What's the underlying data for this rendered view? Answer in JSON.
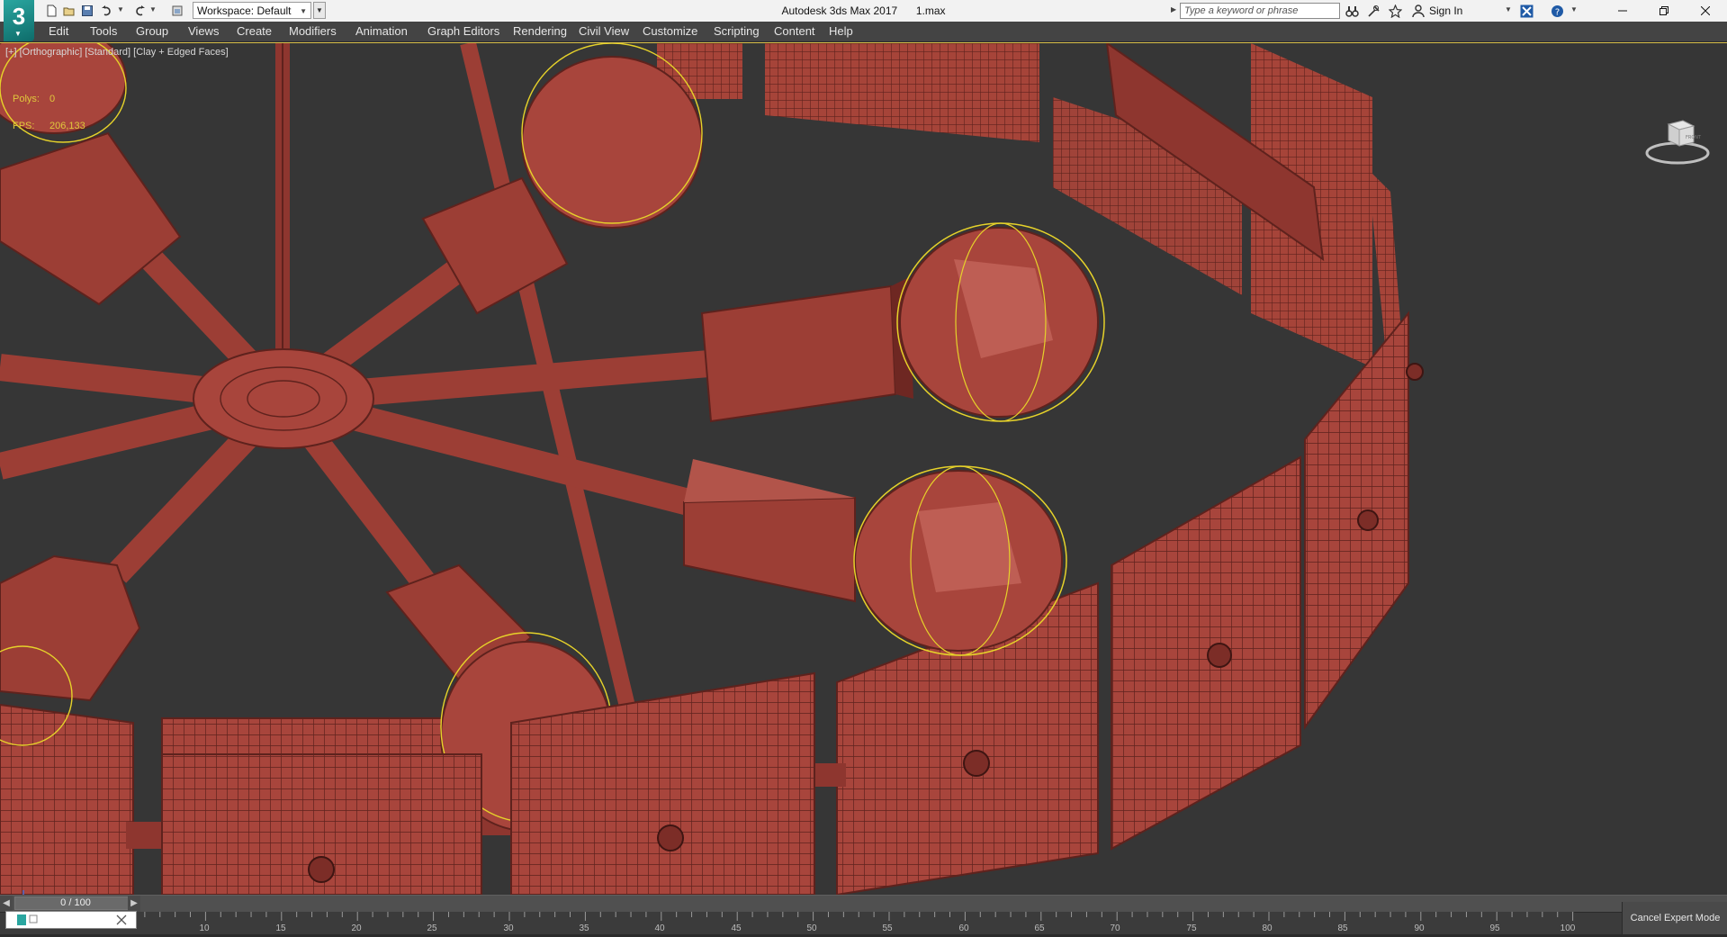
{
  "titlebar": {
    "workspace_label": "Workspace: Default",
    "app_name": "Autodesk 3ds Max 2017",
    "file_name": "1.max",
    "search_placeholder": "Type a keyword or phrase",
    "sign_in": "Sign In",
    "logo_glyph": "3"
  },
  "menu": {
    "items": [
      "Edit",
      "Tools",
      "Group",
      "Views",
      "Create",
      "Modifiers",
      "Animation",
      "Graph Editors",
      "Rendering",
      "Civil View",
      "Customize",
      "Scripting",
      "Content",
      "Help"
    ]
  },
  "viewport": {
    "label": "[+] [Orthographic] [Standard] [Clay + Edged Faces]",
    "stats": {
      "polys_label": "Polys:",
      "polys_value": "0",
      "fps_label": "FPS:",
      "fps_value": "206,133"
    },
    "viewcube_text": "FRONT",
    "colors": {
      "background": "#363636",
      "clay": "#a8453c",
      "clay_dark": "#6e2722",
      "clay_light": "#c86a5e",
      "selection": "#e6d22a",
      "active_border": "#d9c14a"
    }
  },
  "timeline": {
    "frame_counter": "0 / 100",
    "ticks": [
      "10",
      "15",
      "20",
      "25",
      "30",
      "35",
      "40",
      "45",
      "50",
      "55",
      "60",
      "65",
      "70",
      "75",
      "80",
      "85",
      "90",
      "95",
      "100"
    ],
    "cancel_expert": "Cancel Expert Mode"
  },
  "icons": [
    "app-logo",
    "new-file-icon",
    "open-file-icon",
    "save-icon",
    "undo-icon",
    "redo-icon",
    "project-icon",
    "binoculars-icon",
    "search-help-icon",
    "star-icon",
    "user-icon",
    "close-x-icon",
    "help-icon",
    "minimize-icon",
    "restore-icon",
    "close-icon",
    "viewcube-icon",
    "axis-gizmo-icon"
  ]
}
